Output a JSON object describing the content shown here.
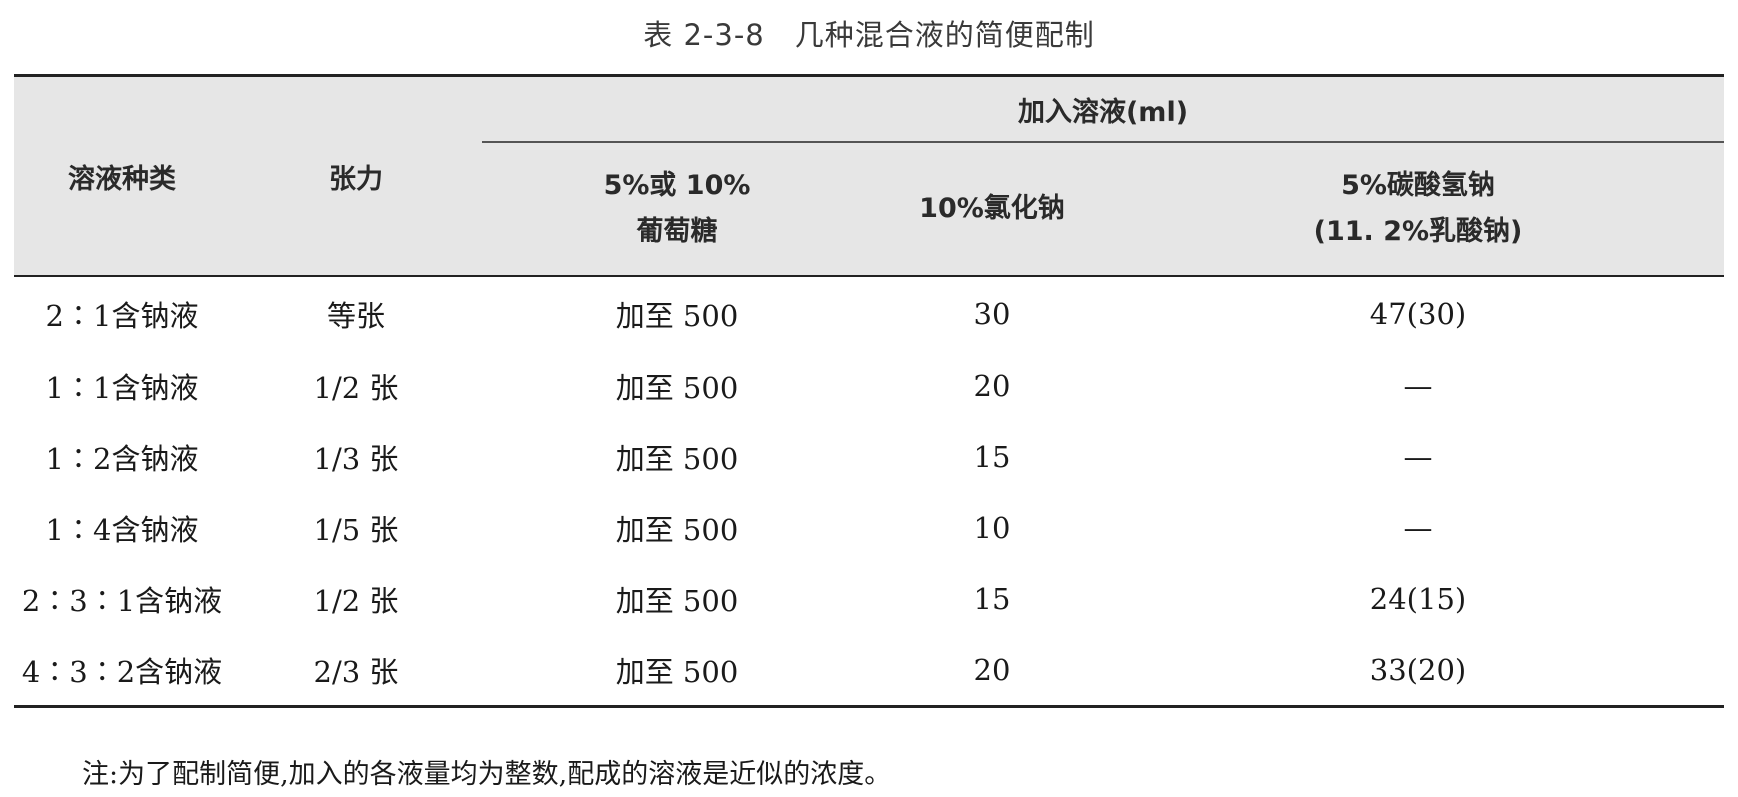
{
  "caption": "表 2-3-8　几种混合液的简便配制",
  "table": {
    "header": {
      "solution_type": "溶液种类",
      "tonicity": "张力",
      "added_group": "加入溶液(ml)",
      "glucose_line1": "5%或 10%",
      "glucose_line2": "葡萄糖",
      "nacl": "10%氯化钠",
      "bicarb_line1": "5%碳酸氢钠",
      "bicarb_line2": "(11. 2%乳酸钠)"
    },
    "rows": [
      {
        "type": "2∶1含钠液",
        "tonicity": "等张",
        "glucose": "加至 500",
        "nacl": "30",
        "bicarb": "47(30)"
      },
      {
        "type": "1∶1含钠液",
        "tonicity": "1/2 张",
        "glucose": "加至 500",
        "nacl": "20",
        "bicarb": "—"
      },
      {
        "type": "1∶2含钠液",
        "tonicity": "1/3 张",
        "glucose": "加至 500",
        "nacl": "15",
        "bicarb": "—"
      },
      {
        "type": "1∶4含钠液",
        "tonicity": "1/5 张",
        "glucose": "加至 500",
        "nacl": "10",
        "bicarb": "—"
      },
      {
        "type": "2∶3∶1含钠液",
        "tonicity": "1/2 张",
        "glucose": "加至 500",
        "nacl": "15",
        "bicarb": "24(15)"
      },
      {
        "type": "4∶3∶2含钠液",
        "tonicity": "2/3 张",
        "glucose": "加至 500",
        "nacl": "20",
        "bicarb": "33(20)"
      }
    ]
  },
  "note": "注:为了配制简便,加入的各液量均为整数,配成的溶液是近似的浓度。"
}
